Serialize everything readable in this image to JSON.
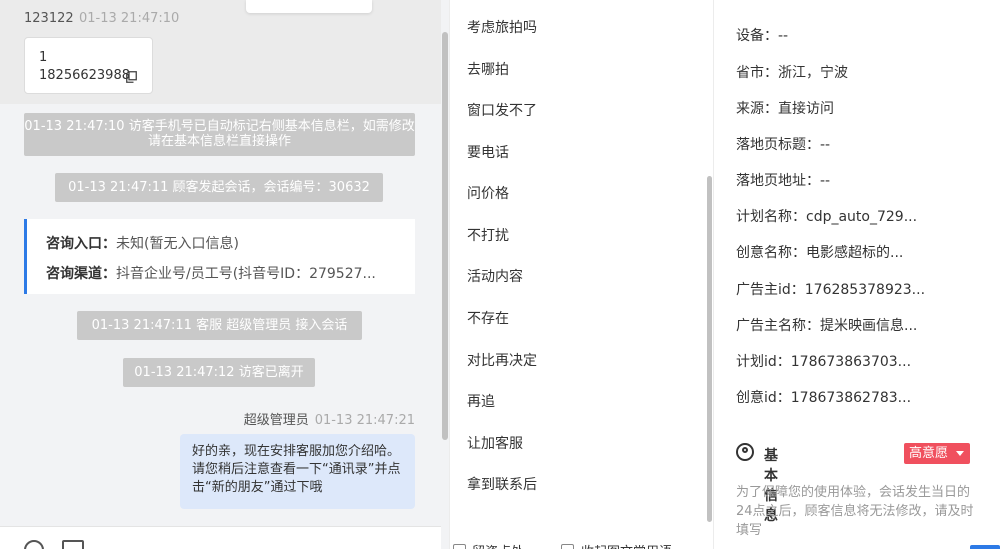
{
  "chat": {
    "visitor": {
      "name": "123122",
      "time": "01-13 21:47:10",
      "message_line1": "1",
      "message_line2": "18256623988"
    },
    "system_messages": [
      "01-13 21:47:10 访客手机号已自动标记右侧基本信息栏，如需修改请在基本信息栏直接操作",
      "01-13 21:47:11 顾客发起会话，会话编号：30632",
      "01-13 21:47:11 客服 超级管理员 接入会话",
      "01-13 21:47:12 访客已离开"
    ],
    "consult_card": {
      "entry_label": "咨询入口：",
      "entry_value": "未知(暂无入口信息)",
      "channel_label": "咨询渠道：",
      "channel_value": "抖音企业号/员工号(抖音号ID：279527..."
    },
    "agent": {
      "name": "超级管理员",
      "time": "01-13 21:47:21",
      "message": "好的亲，现在安排客服加您介绍哈。请您稍后注意查看一下“通讯录”并点击“新的朋友”通过下哦"
    }
  },
  "quick_replies": [
    "考虑旅拍吗",
    "去哪拍",
    "窗口发不了",
    "要电话",
    "问价格",
    "不打扰",
    "活动内容",
    "不存在",
    "对比再决定",
    "再追",
    "让加客服",
    "拿到联系后"
  ],
  "quick_footer": {
    "option1": "留资点处",
    "option2": "收起图文常用语"
  },
  "info": {
    "rows": [
      "设备：--",
      "省市：浙江，宁波",
      "来源：直接访问",
      "落地页标题：--",
      "落地页地址：--",
      "计划名称：cdp_auto_729...",
      "创意名称：电影感超标的...",
      "广告主id：176285378923...",
      "广告主名称：提米映画信息...",
      "计划id：178673863703...",
      "创意id：178673862783..."
    ],
    "basic_title": "基本信息",
    "intent_badge": "高意愿",
    "basic_note": "为了保障您的使用体验，会话发生当日的24点之后，顾客信息将无法修改，请及时填写"
  }
}
